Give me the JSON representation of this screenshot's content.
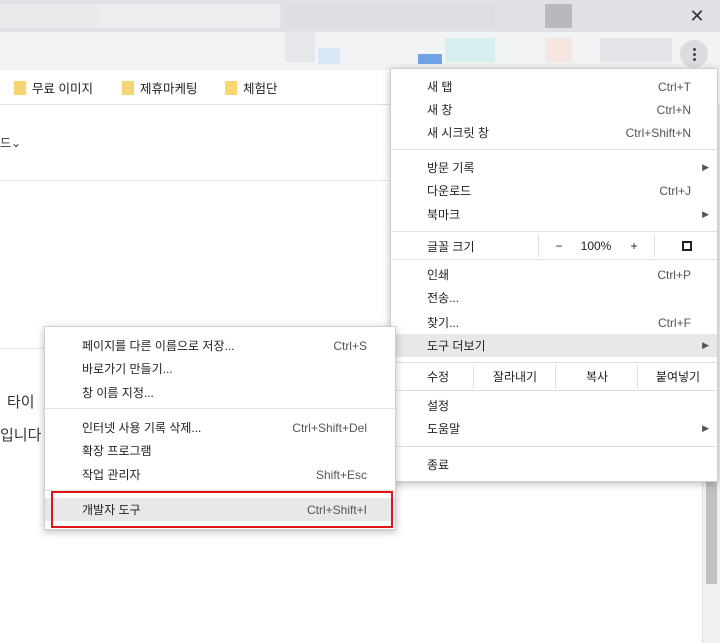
{
  "window": {
    "close_glyph": "✕"
  },
  "bookmarks": [
    {
      "label": "무료 이미지",
      "icon": "folder-icon"
    },
    {
      "label": "제휴마케팅",
      "icon": "folder-icon"
    },
    {
      "label": "체험단",
      "icon": "folder-icon"
    }
  ],
  "page": {
    "frag_download": "드⌄",
    "frag_title": "타이",
    "frag_text": "입니다"
  },
  "menu": {
    "new_tab": {
      "label": "새 탭",
      "shortcut": "Ctrl+T"
    },
    "new_window": {
      "label": "새 창",
      "shortcut": "Ctrl+N"
    },
    "new_incognito": {
      "label": "새 시크릿 창",
      "shortcut": "Ctrl+Shift+N"
    },
    "history": {
      "label": "방문 기록"
    },
    "downloads": {
      "label": "다운로드",
      "shortcut": "Ctrl+J"
    },
    "bookmarks": {
      "label": "북마크"
    },
    "zoom": {
      "label": "글꼴 크기",
      "minus": "−",
      "value": "100%",
      "plus": "+"
    },
    "print": {
      "label": "인쇄",
      "shortcut": "Ctrl+P"
    },
    "cast": {
      "label": "전송..."
    },
    "find": {
      "label": "찾기...",
      "shortcut": "Ctrl+F"
    },
    "more_tools": {
      "label": "도구 더보기"
    },
    "edit": {
      "label": "수정",
      "cut": "잘라내기",
      "copy": "복사",
      "paste": "붙여넣기"
    },
    "settings": {
      "label": "설정"
    },
    "help": {
      "label": "도움말"
    },
    "exit": {
      "label": "종료"
    }
  },
  "submenu": {
    "save_page": {
      "label": "페이지를 다른 이름으로 저장...",
      "shortcut": "Ctrl+S"
    },
    "create_shortcut": {
      "label": "바로가기 만들기..."
    },
    "name_window": {
      "label": "창 이름 지정..."
    },
    "clear_data": {
      "label": "인터넷 사용 기록 삭제...",
      "shortcut": "Ctrl+Shift+Del"
    },
    "extensions": {
      "label": "확장 프로그램"
    },
    "task_manager": {
      "label": "작업 관리자",
      "shortcut": "Shift+Esc"
    },
    "dev_tools": {
      "label": "개발자 도구",
      "shortcut": "Ctrl+Shift+I"
    }
  },
  "colors": {
    "highlight_box": "#e0161b",
    "menu_hover": "#e8e8e8",
    "folder": "#f7d570"
  }
}
